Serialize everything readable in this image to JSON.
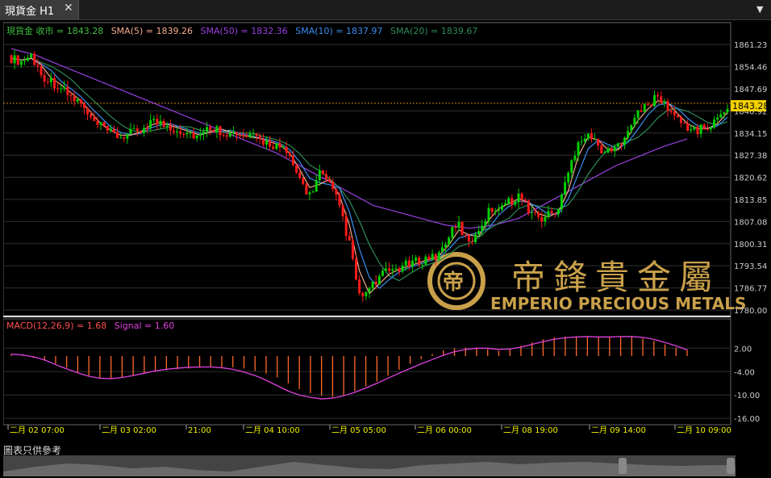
{
  "tab": {
    "title": "現貨金 H1",
    "close": "✕",
    "menu": "▼"
  },
  "colors": {
    "up": "#00d000",
    "down": "#ff1a1a",
    "sma5": "#f5a98b",
    "sma50": "#9a40e0",
    "sma10": "#3a8ef0",
    "sma20": "#2e8b57",
    "close_line": "#cc8800",
    "macd_hist": "#ff6a2a",
    "signal": "#e040e0",
    "grid": "#2a2a2a",
    "axis_text": "#cccccc",
    "date_text": "#f0f000",
    "price_tag_bg": "#f2d000"
  },
  "legend": {
    "symbol": "現貨金 收市 = 1843.28",
    "sma5": "SMA(5) = 1839.26",
    "sma50": "SMA(50) = 1832.36",
    "sma10": "SMA(10) = 1837.97",
    "sma20": "SMA(20) = 1839.67"
  },
  "macd_legend": {
    "macd": "MACD(12,26,9) = 1.68",
    "signal": "Signal = 1.60"
  },
  "current_price": "1843.28",
  "watermark": {
    "chinese": "帝鋒貴金屬",
    "english": "EMPERIO PRECIOUS METALS"
  },
  "footnote": "圖表只供參考",
  "chart_data": [
    {
      "type": "candlestick",
      "title": "現貨金 H1",
      "y_ticks": [
        "1861.23",
        "1854.46",
        "1847.69",
        "1840.92",
        "1834.15",
        "1827.38",
        "1820.62",
        "1813.85",
        "1807.08",
        "1800.31",
        "1793.54",
        "1786.77",
        "1780.00"
      ],
      "ylim": [
        1780.0,
        1863.0
      ],
      "x_ticks": [
        "二月 02 07:00",
        "二月 03 02:00",
        "21:00",
        "二月 04 10:00",
        "二月 05 05:00",
        "二月 06 00:00",
        "二月 08 19:00",
        "二月 09 14:00",
        "二月 10 09:00"
      ],
      "series": [
        {
          "name": "現貨金 收市",
          "last": 1843.28
        },
        {
          "name": "SMA(5)",
          "last": 1839.26
        },
        {
          "name": "SMA(50)",
          "last": 1832.36
        },
        {
          "name": "SMA(10)",
          "last": 1837.97
        },
        {
          "name": "SMA(20)",
          "last": 1839.67
        }
      ],
      "close_path": [
        1857,
        1856,
        1858,
        1852,
        1850,
        1848,
        1845,
        1843,
        1838,
        1836,
        1834,
        1833,
        1834,
        1835,
        1838,
        1837,
        1836,
        1835,
        1834,
        1833,
        1836,
        1835,
        1834,
        1833,
        1833,
        1832,
        1831,
        1830,
        1826,
        1820,
        1815,
        1822,
        1818,
        1812,
        1800,
        1784,
        1786,
        1790,
        1792,
        1793,
        1794,
        1795,
        1796,
        1797,
        1803,
        1806,
        1800,
        1805,
        1810,
        1812,
        1813,
        1815,
        1811,
        1808,
        1809,
        1811,
        1822,
        1832,
        1834,
        1830,
        1828,
        1830,
        1836,
        1840,
        1843,
        1845,
        1842,
        1838,
        1836,
        1835,
        1836,
        1838,
        1843
      ],
      "sma50_path": [
        1860,
        1858,
        1855,
        1852,
        1849,
        1846,
        1843,
        1840,
        1837,
        1834,
        1831,
        1828,
        1824,
        1820,
        1816,
        1812,
        1810,
        1808,
        1806,
        1805,
        1806,
        1808,
        1812,
        1816,
        1820,
        1824,
        1827,
        1830,
        1832.36
      ]
    },
    {
      "type": "macd",
      "title": "MACD(12,26,9)",
      "y_ticks": [
        "2.00",
        "-4.00",
        "-10.00",
        "-16.00"
      ],
      "ylim": [
        -17,
        6
      ],
      "series": [
        {
          "name": "MACD(12,26,9)",
          "last": 1.68
        },
        {
          "name": "Signal",
          "last": 1.6
        }
      ],
      "hist": [
        0.5,
        0.2,
        -0.5,
        -1.2,
        -2.0,
        -3.0,
        -4.2,
        -5.0,
        -5.6,
        -5.8,
        -5.5,
        -5.0,
        -4.5,
        -4.0,
        -3.6,
        -3.4,
        -3.2,
        -3.0,
        -2.9,
        -2.8,
        -2.9,
        -3.2,
        -3.8,
        -4.5,
        -5.5,
        -7.0,
        -8.5,
        -9.5,
        -10.2,
        -10.5,
        -10.0,
        -9.0,
        -7.8,
        -6.5,
        -5.0,
        -3.5,
        -2.0,
        -0.8,
        0.5,
        1.5,
        2.0,
        2.2,
        2.2,
        1.8,
        1.4,
        1.8,
        2.6,
        3.5,
        4.3,
        4.8,
        5.0,
        5.0,
        4.9,
        4.8,
        4.9,
        5.0,
        4.9,
        4.5,
        3.9,
        3.0,
        2.2,
        1.7
      ],
      "signal": [
        0.5,
        0.3,
        -0.2,
        -1.0,
        -2.2,
        -3.3,
        -4.3,
        -5.2,
        -5.7,
        -5.8,
        -5.5,
        -5.0,
        -4.4,
        -3.8,
        -3.4,
        -3.1,
        -2.9,
        -2.8,
        -2.8,
        -3.0,
        -3.4,
        -4.1,
        -5.0,
        -6.2,
        -7.6,
        -9.0,
        -10.0,
        -10.6,
        -11.0,
        -10.8,
        -10.2,
        -9.3,
        -8.2,
        -7.0,
        -5.7,
        -4.4,
        -3.2,
        -2.0,
        -0.9,
        0.2,
        1.1,
        1.7,
        2.0,
        2.0,
        1.7,
        1.8,
        2.3,
        3.0,
        3.7,
        4.3,
        4.7,
        4.9,
        5.0,
        4.9,
        4.9,
        5.0,
        5.0,
        4.8,
        4.3,
        3.5,
        2.6,
        1.6
      ]
    }
  ]
}
